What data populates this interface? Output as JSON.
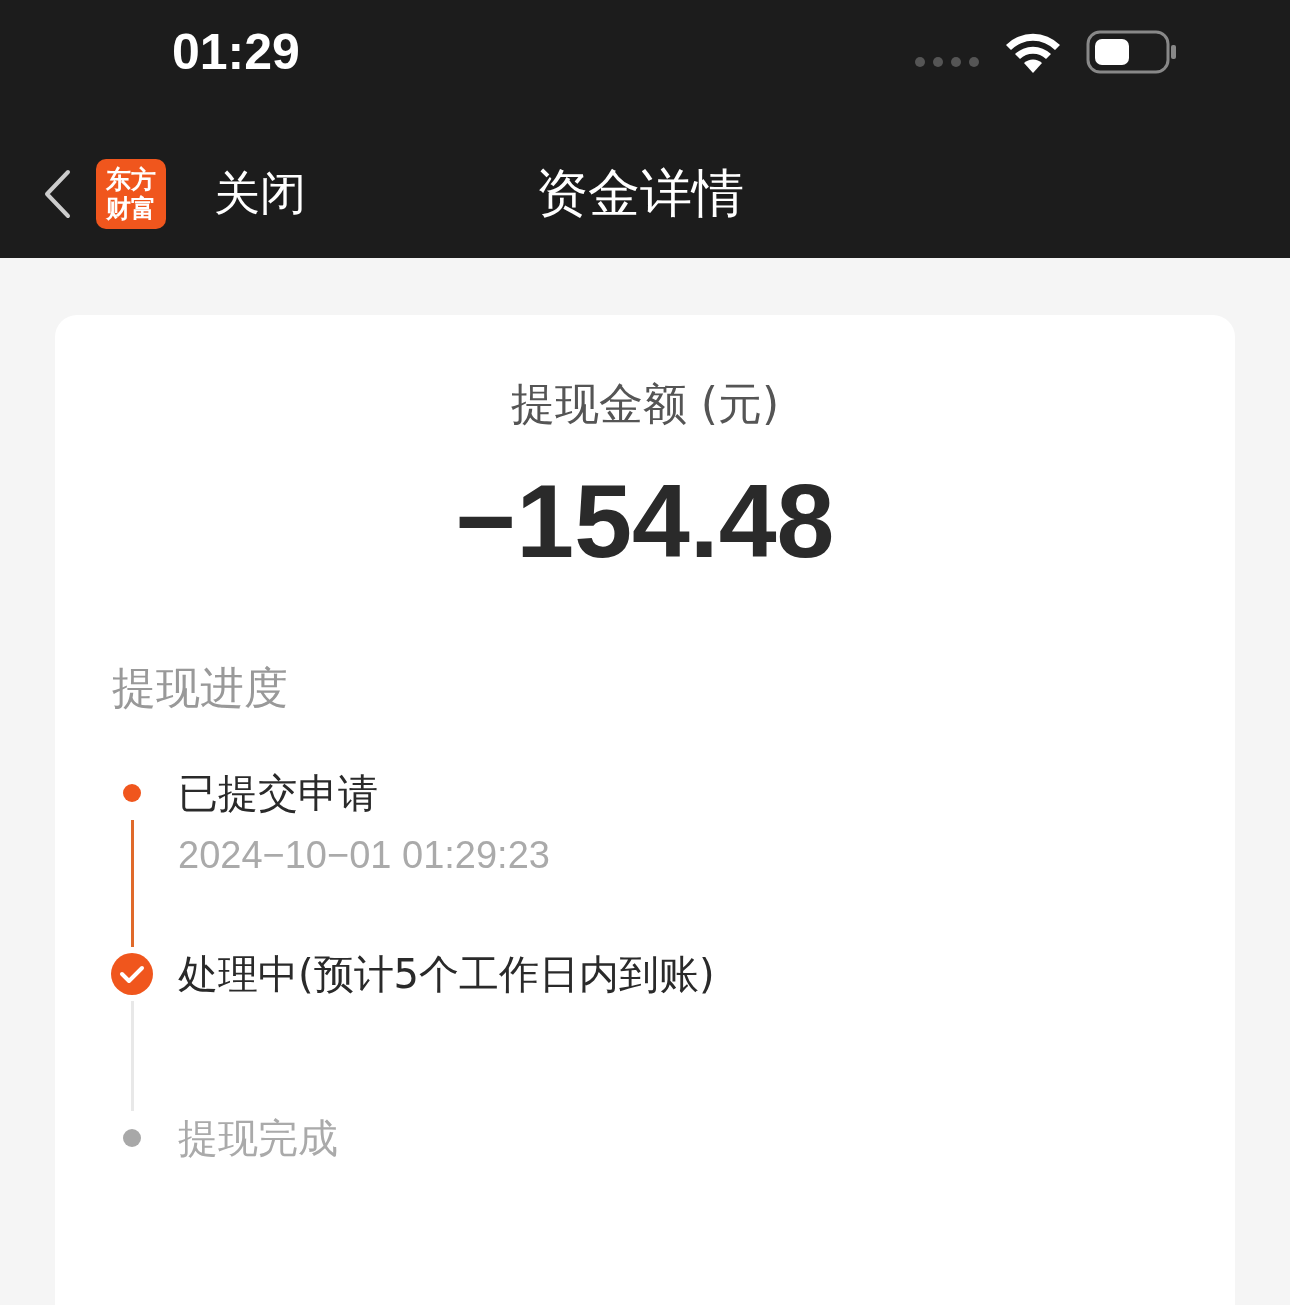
{
  "status_bar": {
    "time": "01:29"
  },
  "nav": {
    "logo": "东方财富",
    "close": "关闭",
    "title": "资金详情"
  },
  "summary": {
    "label": "提现金额 (元)",
    "amount": "−154.48"
  },
  "progress": {
    "title": "提现进度",
    "steps": [
      {
        "title": "已提交申请",
        "time": "2024−10−01 01:29:23",
        "kind": "done"
      },
      {
        "title": "处理中(预计5个工作日内到账)",
        "kind": "current"
      },
      {
        "title": "提现完成",
        "kind": "pending"
      }
    ]
  }
}
